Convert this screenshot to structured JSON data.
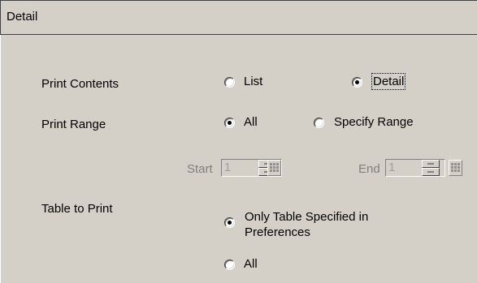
{
  "header": {
    "title": "Detail"
  },
  "print_contents": {
    "label": "Print Contents",
    "options": [
      {
        "label": "List",
        "selected": false
      },
      {
        "label": "Detail",
        "selected": true
      }
    ]
  },
  "print_range": {
    "label": "Print Range",
    "options": [
      {
        "label": "All",
        "selected": true
      },
      {
        "label": "Specify Range",
        "selected": false
      }
    ],
    "start_label": "Start",
    "start_value": "1",
    "end_label": "End",
    "end_value": "1"
  },
  "table_to_print": {
    "label": "Table to Print",
    "options": [
      {
        "label_line1": "Only Table Specified in",
        "label_line2": "Preferences",
        "selected": true
      },
      {
        "label": "All",
        "selected": false
      }
    ]
  }
}
